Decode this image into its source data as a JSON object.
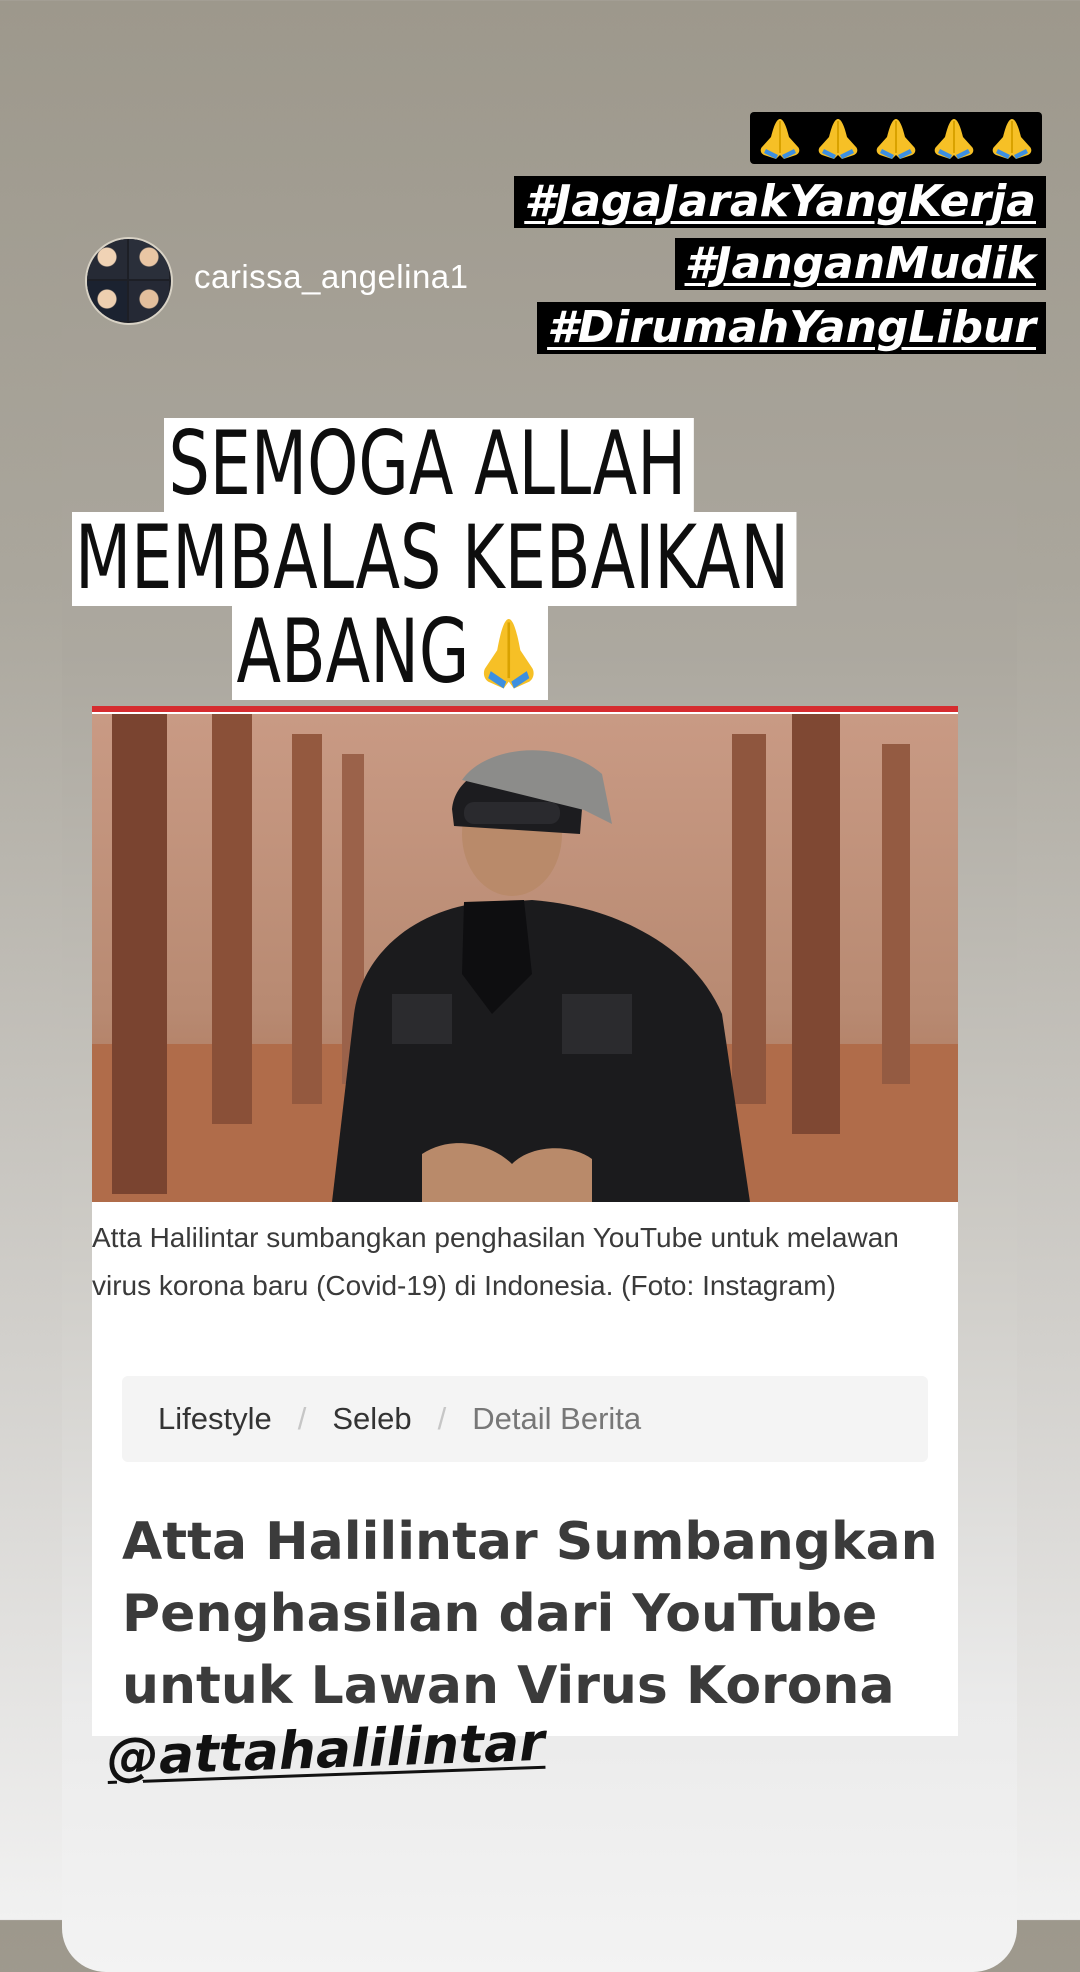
{
  "story": {
    "username": "carissa_angelina1",
    "emoji_count": 5,
    "emoji_icon": "folded-hands-icon",
    "hashtags": [
      "#JagaJarakYangKerja",
      "#JanganMudik",
      "#DirumahYangLibur"
    ],
    "caption_lines": [
      "SEMOGA ALLAH",
      "MEMBALAS KEBAIKAN",
      "ABANG"
    ],
    "mention": "@attahalilintar"
  },
  "article": {
    "accent_color": "#d62c2f",
    "photo_caption": "Atta Halilintar sumbangkan penghasilan YouTube untuk melawan virus korona baru (Covid-19) di Indonesia. (Foto: Instagram)",
    "breadcrumb": [
      "Lifestyle",
      "Seleb",
      "Detail Berita"
    ],
    "headline": "Atta Halilintar Sumbangkan Penghasilan dari YouTube untuk Lawan Virus Korona"
  }
}
